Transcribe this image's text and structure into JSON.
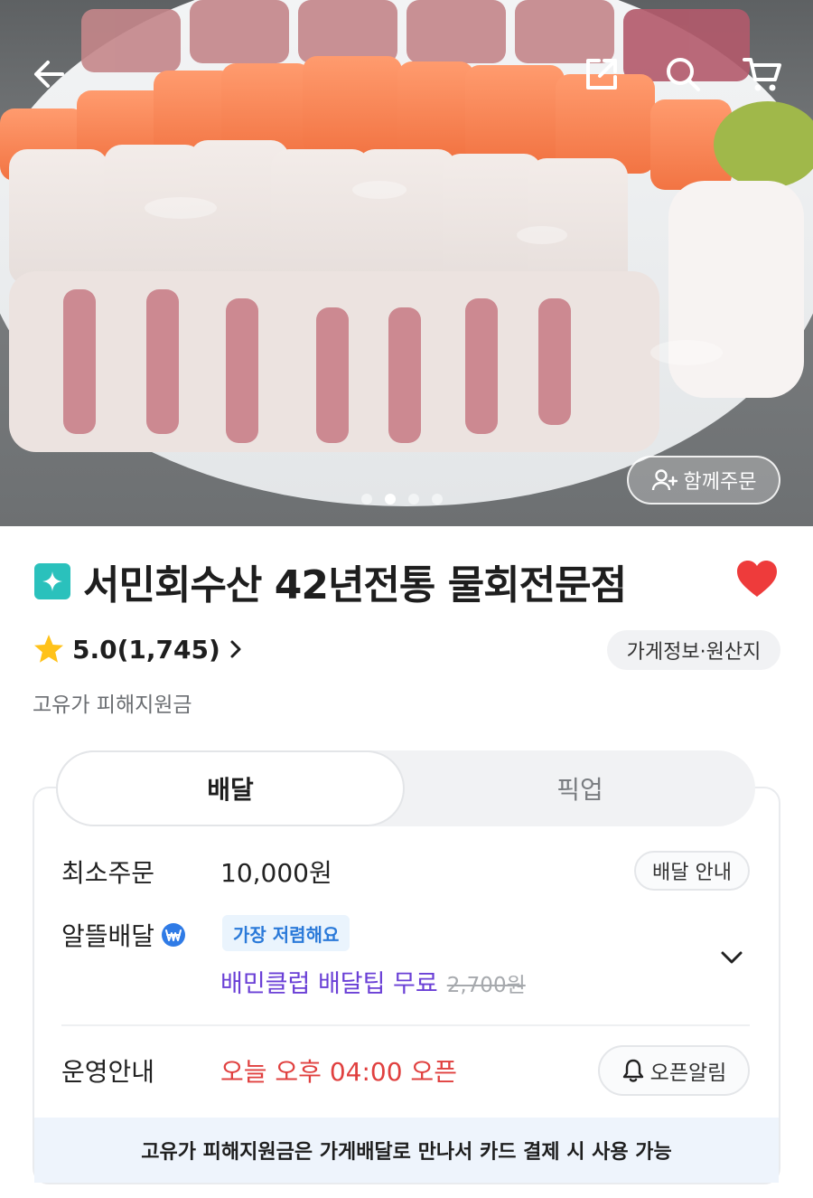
{
  "header": {
    "back_icon": "arrow-left-icon",
    "share_icon": "share-icon",
    "search_icon": "search-icon",
    "cart_icon": "cart-icon"
  },
  "hero": {
    "together_order_label": "함께주문",
    "page_dots": 4,
    "active_dot": 2
  },
  "store": {
    "name": "서민회수산 42년전통 물회전문점",
    "favorite": true,
    "rating": "5.0(1,745)",
    "info_button": "가게정보·원산지",
    "subsidy_label": "고유가 피해지원금"
  },
  "tabs": [
    {
      "label": "배달",
      "active": true
    },
    {
      "label": "픽업",
      "active": false
    }
  ],
  "delivery": {
    "min_order_label": "최소주문",
    "min_order_value": "10,000원",
    "delivery_info_button": "배달 안내",
    "saver_label": "알뜰배달",
    "cheapest_tag": "가장 저렴해요",
    "baemin_club_text": "배민클럽 배달팁 무료",
    "original_tip": "2,700원",
    "hours_label": "운영안내",
    "open_time": "오늘 오후 04:00 오픈",
    "open_alarm_button": "오픈알림",
    "notice": "고유가 피해지원금은 가게배달로 만나서 카드 결제 시 사용 가능"
  },
  "colors": {
    "brand_mint": "#2ac1bc",
    "heart_red": "#ee3b3b",
    "star_yellow": "#ffc21a",
    "baemin_purple": "#6a3fd6",
    "open_red": "#e0403f",
    "tag_blue": "#2b7ad9"
  }
}
